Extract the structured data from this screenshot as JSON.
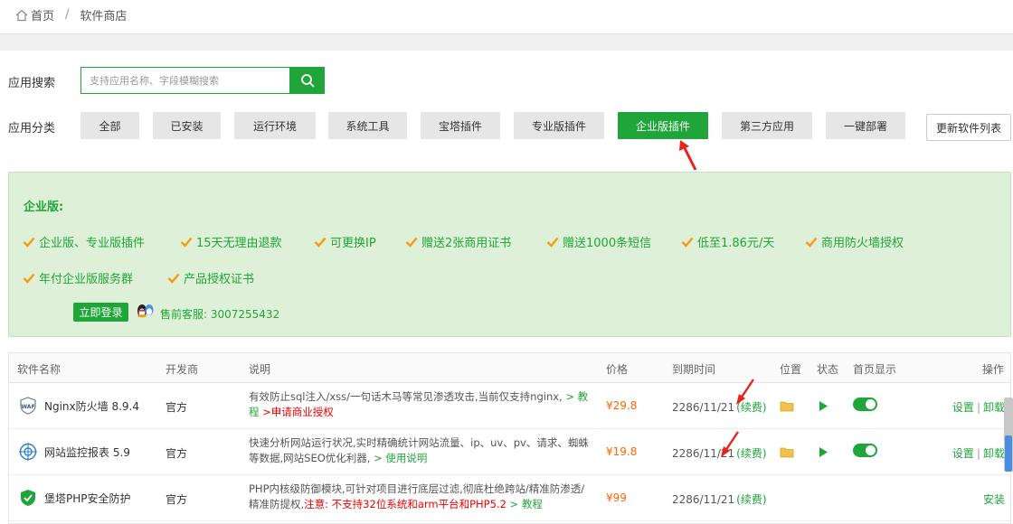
{
  "breadcrumb": {
    "home": "首页",
    "separator": "/",
    "current": "软件商店"
  },
  "search": {
    "label": "应用搜索",
    "placeholder": "支持应用名称、字段模糊搜索"
  },
  "categories": {
    "label": "应用分类",
    "items": [
      "全部",
      "已安装",
      "运行环境",
      "系统工具",
      "宝塔插件",
      "专业版插件",
      "企业版插件",
      "第三方应用",
      "一键部署"
    ],
    "active_index": 6,
    "refresh_label": "更新软件列表"
  },
  "promo": {
    "title": "企业版:",
    "features": [
      "企业版、专业版插件",
      "15天无理由退款",
      "可更换IP",
      "赠送2张商用证书",
      "赠送1000条短信",
      "低至1.86元/天",
      "商用防火墙授权",
      "年付企业版服务群",
      "产品授权证书"
    ],
    "login_label": "立即登录",
    "service_label": "售前客服: 3007255432"
  },
  "table": {
    "headers": [
      "软件名称",
      "开发商",
      "说明",
      "价格",
      "到期时间",
      "位置",
      "状态",
      "首页显示",
      "操作"
    ],
    "rows": [
      {
        "name": "Nginx防火墙 8.9.4",
        "icon": "waf-icon",
        "developer": "官方",
        "desc_main": "有效防止sql注入/xss/一句话木马等常见渗透攻击,当前仅支持nginx, ",
        "desc_link": "> 教程",
        "desc_red": " >申请商业授权",
        "price": "¥29.8",
        "expire": "2286/11/21",
        "renew": "(续费)",
        "ops": [
          "设置",
          "卸载"
        ]
      },
      {
        "name": "网站监控报表 5.9",
        "icon": "monitor-icon",
        "developer": "官方",
        "desc_main": "快速分析网站运行状况,实时精确统计网站流量、ip、uv、pv、请求、蜘蛛等数据,网站SEO优化利器, ",
        "desc_link": "> 使用说明",
        "desc_red": "",
        "price": "¥19.8",
        "expire": "2286/11/21",
        "renew": "(续费)",
        "ops": [
          "设置",
          "卸载"
        ]
      },
      {
        "name": "堡塔PHP安全防护",
        "icon": "php-shield-icon",
        "developer": "官方",
        "desc_main": "PHP内核级防御模块,可针对项目进行底层过滤,彻底杜绝跨站/精准防渗透/精准防提权,",
        "desc_link": "",
        "desc_red": "注意: 不支持32位系统和arm平台和PHP5.2",
        "desc_tail": " > 教程",
        "price": "¥99",
        "expire": "2286/11/21",
        "renew": "(续费)",
        "ops": [
          "安装"
        ]
      }
    ]
  },
  "colors": {
    "accent": "#20a53a",
    "price": "#ff6600",
    "warning": "#ee0000",
    "promo_bg": "#dff0d8"
  }
}
